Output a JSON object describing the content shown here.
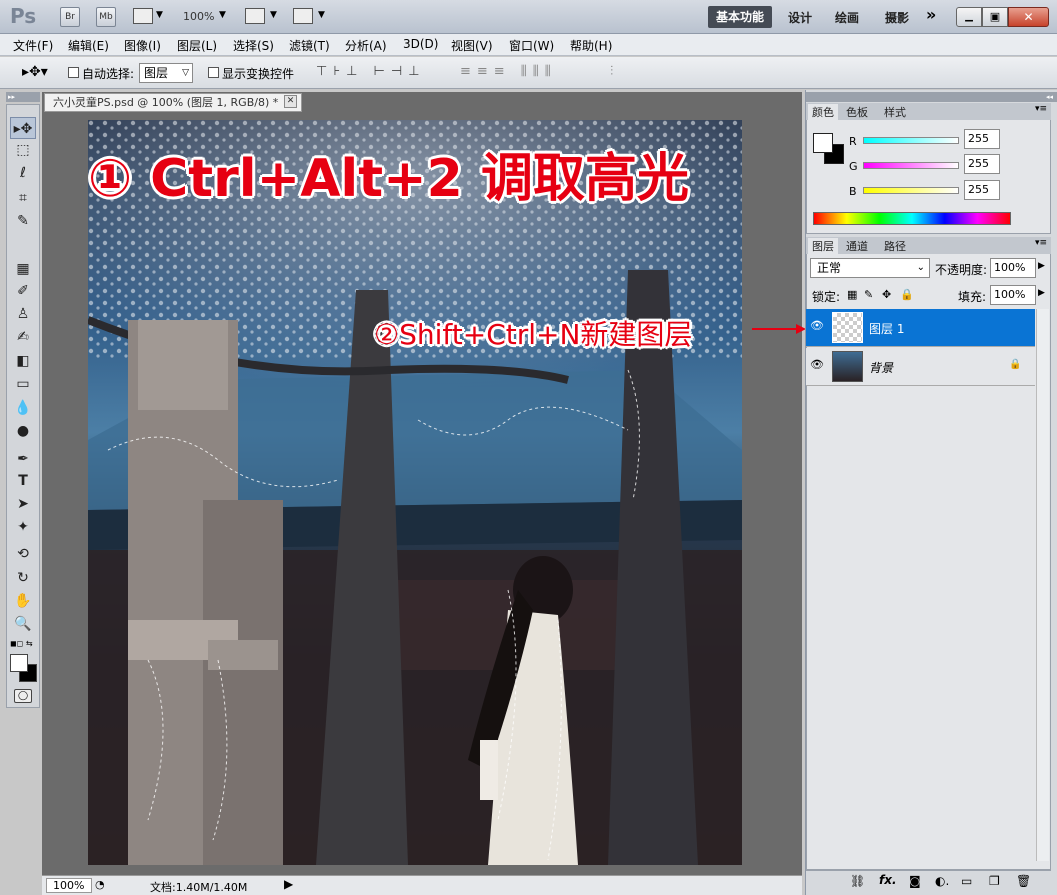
{
  "app": {
    "logo": "Ps",
    "zoom": "100%",
    "workspace_active": "基本功能",
    "workspaces": [
      "设计",
      "绘画",
      "摄影"
    ],
    "bridge_label": "Br",
    "minibridge_label": "Mb"
  },
  "menus": [
    "文件(F)",
    "编辑(E)",
    "图像(I)",
    "图层(L)",
    "选择(S)",
    "滤镜(T)",
    "分析(A)",
    "3D(D)",
    "视图(V)",
    "窗口(W)",
    "帮助(H)"
  ],
  "options": {
    "auto_select_label": "自动选择:",
    "auto_select_value": "图层",
    "show_transform_label": "显示变换控件"
  },
  "document": {
    "tab_title": "六小灵童PS.psd @ 100% (图层 1, RGB/8) *",
    "zoom": "100%",
    "doc_size": "文档:1.40M/1.40M"
  },
  "annotations": {
    "step1": "① Ctrl+Alt+2 调取高光",
    "step2": "②Shift+Ctrl+N新建图层"
  },
  "color_panel": {
    "tabs": [
      "颜色",
      "色板",
      "样式"
    ],
    "r_label": "R",
    "g_label": "G",
    "b_label": "B",
    "r": "255",
    "g": "255",
    "b": "255"
  },
  "layers_panel": {
    "tabs": [
      "图层",
      "通道",
      "路径"
    ],
    "blend_mode": "正常",
    "opacity_label": "不透明度:",
    "opacity": "100%",
    "lock_label": "锁定:",
    "fill_label": "填充:",
    "fill": "100%",
    "layers": [
      {
        "name": "图层 1",
        "selected": true
      },
      {
        "name": "背景",
        "selected": false
      }
    ]
  },
  "colors": {
    "accent_red": "#e60012",
    "selection_blue": "#0a74d4"
  }
}
